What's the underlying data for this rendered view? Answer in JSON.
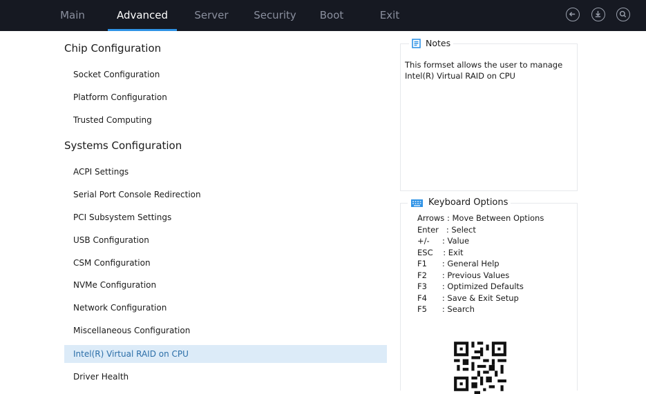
{
  "tabs": [
    {
      "label": "Main"
    },
    {
      "label": "Advanced"
    },
    {
      "label": "Server"
    },
    {
      "label": "Security"
    },
    {
      "label": "Boot"
    },
    {
      "label": "Exit"
    }
  ],
  "active_tab": "Advanced",
  "top_icons": [
    "back-icon",
    "download-icon",
    "search-icon"
  ],
  "sections": [
    {
      "title": "Chip Configuration",
      "items": [
        "Socket Configuration",
        "Platform Configuration",
        "Trusted Computing"
      ]
    },
    {
      "title": "Systems Configuration",
      "items": [
        "ACPI Settings",
        "Serial Port Console Redirection",
        "PCI Subsystem Settings",
        "USB Configuration",
        "CSM Configuration",
        "NVMe Configuration",
        "Network Configuration",
        "Miscellaneous Configuration",
        "Intel(R) Virtual RAID on CPU",
        "Driver Health"
      ]
    }
  ],
  "selected_item": "Intel(R) Virtual RAID on CPU",
  "notes": {
    "title": "Notes",
    "text": "This formset allows the user to manage Intel(R) Virtual RAID on CPU"
  },
  "keyboard": {
    "title": "Keyboard Options",
    "rows": [
      "Arrows : Move Between Options",
      "Enter   : Select",
      "+/-     : Value",
      "ESC    : Exit",
      "F1      : General Help",
      "F2      : Previous Values",
      "F3      : Optimized Defaults",
      "F4      : Save & Exit Setup",
      "F5      : Search"
    ]
  },
  "colors": {
    "topbar": "#161922",
    "accent": "#2f93e6",
    "selected_bg": "#dcebf8"
  }
}
